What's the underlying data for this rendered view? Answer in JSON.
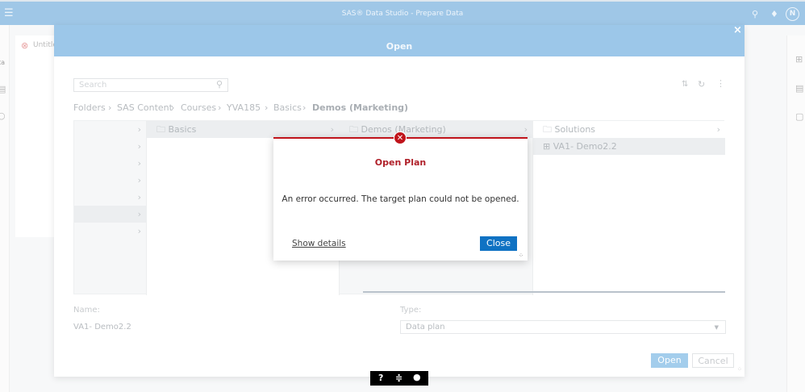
{
  "app": {
    "title": "SAS® Data Studio - Prepare Data",
    "user_initial": "N",
    "tab_label": "Untitled",
    "left_fragment": "ta"
  },
  "dialog": {
    "title": "Open",
    "search_placeholder": "Search",
    "breadcrumb": [
      "Folders",
      "SAS Content",
      "Courses",
      "YVA185",
      "Basics",
      "Demos (Marketing)"
    ],
    "columns": [
      {
        "items": [
          "",
          "",
          "",
          "",
          "",
          "",
          ""
        ],
        "selected_index": 5
      },
      {
        "items": [
          "Basics"
        ]
      },
      {
        "items": [
          "Demos (Marketing)"
        ]
      },
      {
        "items": [
          "Solutions",
          "VA1- Demo2.2"
        ],
        "selected_index": 1
      }
    ],
    "name_label": "Name:",
    "name_value": "VA1- Demo2.2",
    "type_label": "Type:",
    "type_value": "Data plan",
    "open_button": "Open",
    "cancel_button": "Cancel"
  },
  "error": {
    "title": "Open Plan",
    "message": "An error occurred. The target plan could not be opened.",
    "details_link": "Show details",
    "close_button": "Close",
    "accent": "#c0141b"
  },
  "colors": {
    "header": "#9cc7e9",
    "primary": "#0f72c3"
  }
}
